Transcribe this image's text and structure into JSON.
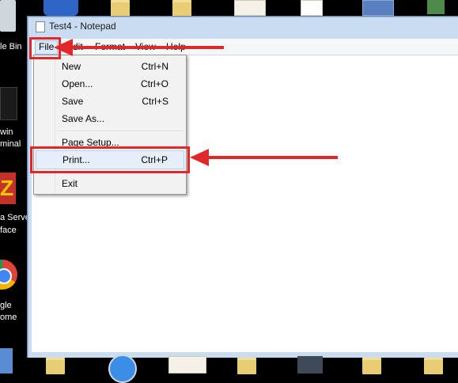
{
  "desktop": {
    "labels": [
      "le Bin",
      "win",
      "minal",
      "a Serve",
      "face",
      "gle",
      "ome"
    ]
  },
  "window": {
    "title": "Test4 - Notepad",
    "menu": [
      "File",
      "Edit",
      "Format",
      "View",
      "Help"
    ]
  },
  "file_menu": {
    "items": [
      {
        "label": "New",
        "shortcut": "Ctrl+N"
      },
      {
        "label": "Open...",
        "shortcut": "Ctrl+O"
      },
      {
        "label": "Save",
        "shortcut": "Ctrl+S"
      },
      {
        "label": "Save As...",
        "shortcut": ""
      },
      {
        "label": "Page Setup...",
        "shortcut": ""
      },
      {
        "label": "Print...",
        "shortcut": "Ctrl+P"
      },
      {
        "label": "Exit",
        "shortcut": ""
      }
    ]
  },
  "annotation_color": "#e0282a"
}
